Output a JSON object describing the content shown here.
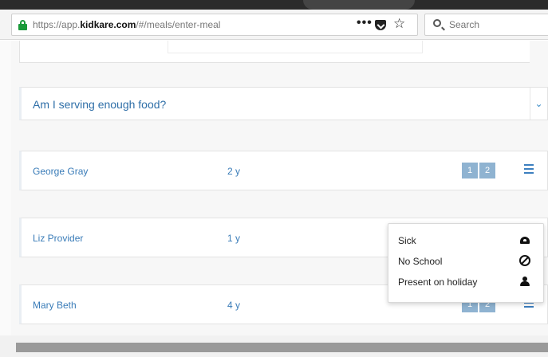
{
  "browser": {
    "url_prefix": "https://app.",
    "url_domain": "kidkare.com",
    "url_path": "/#/meals/enter-meal",
    "search_placeholder": "Search",
    "more_label": "•••",
    "bookmark_icon": "star-icon",
    "pocket_icon": "pocket-icon",
    "lock_color": "#1a9a3a"
  },
  "faq": {
    "label": "Am I serving enough food?",
    "chevron": "⌄"
  },
  "children": [
    {
      "name": "George Gray",
      "age": "2 y",
      "buttons": [
        "1",
        "2"
      ]
    },
    {
      "name": "Liz Provider",
      "age": "1 y",
      "buttons": []
    },
    {
      "name": "Mary Beth",
      "age": "4 y",
      "buttons": [
        "1",
        "2"
      ]
    }
  ],
  "dropdown": {
    "items": [
      {
        "label": "Sick",
        "icon": "sick-icon"
      },
      {
        "label": "No School",
        "icon": "no-school-icon"
      },
      {
        "label": "Present on holiday",
        "icon": "person-icon"
      }
    ]
  },
  "colors": {
    "link_blue": "#3a7cb8",
    "button_blue": "#8fb3d1",
    "menu_blue": "#3c7fbf"
  }
}
